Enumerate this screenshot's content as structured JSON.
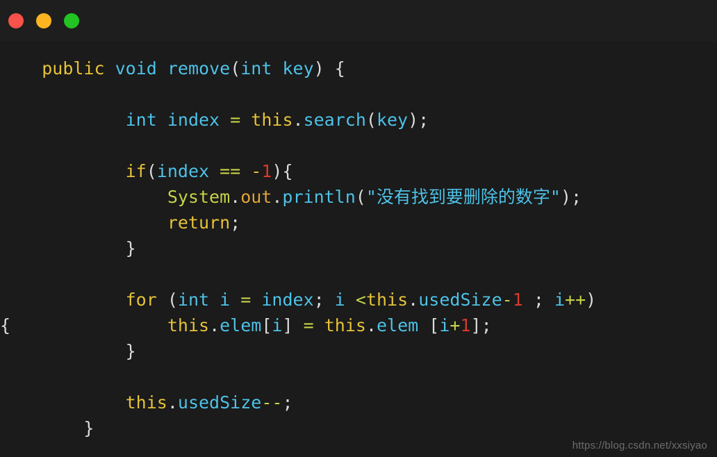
{
  "window": {
    "controls": [
      {
        "name": "close",
        "label": "Close",
        "color": "#f9524a"
      },
      {
        "name": "minimize",
        "label": "Minimize",
        "color": "#fcb521"
      },
      {
        "name": "maximize",
        "label": "Maximize",
        "color": "#22c322"
      }
    ]
  },
  "editor": {
    "language": "Java",
    "background": "#1b1b1b",
    "theme_colors": {
      "keyword": "#e6c33b",
      "identifier": "#4fc3e8",
      "operator": "#c8d44a",
      "number": "#d83c2c",
      "punctuation": "#dcdcdc",
      "class": "#c8d44a",
      "field": "#e0a63a",
      "string": "#4fc3e8"
    },
    "lines": {
      "l1_public": "public",
      "l1_void": "void",
      "l1_remove": "remove",
      "l1_paren_open": "(",
      "l1_int": "int",
      "l1_key": "key",
      "l1_paren_close": ")",
      "l1_brace": "{",
      "l3_int": "int",
      "l3_index": "index",
      "l3_eq": "=",
      "l3_this": "this",
      "l3_dot": ".",
      "l3_search": "search",
      "l3_paren_open": "(",
      "l3_key": "key",
      "l3_tail": ");",
      "l5_if": "if",
      "l5_paren_open": "(",
      "l5_index": "index",
      "l5_eqeq": "==",
      "l5_minus": "-",
      "l5_one": "1",
      "l5_tail": "){",
      "l6_system": "System",
      "l6_dot1": ".",
      "l6_out": "out",
      "l6_dot2": ".",
      "l6_println": "println",
      "l6_paren_open": "(",
      "l6_string": "\"没有找到要删除的数字\"",
      "l6_tail": ");",
      "l7_return": "return",
      "l7_semi": ";",
      "l8_close": "}",
      "l10_for": "for",
      "l10_paren_open": "(",
      "l10_int": "int",
      "l10_i": "i",
      "l10_eq": "=",
      "l10_index": "index",
      "l10_semi1": ";",
      "l10_i2": "i",
      "l10_lt": "<",
      "l10_this": "this",
      "l10_dot": ".",
      "l10_usedSize": "usedSize",
      "l10_minus": "-",
      "l10_one": "1",
      "l10_semi2": ";",
      "l10_i3": "i",
      "l10_inc": "++",
      "l10_paren_close": ")",
      "l11_wrap_brace": "{",
      "l11_this1": "this",
      "l11_dot1": ".",
      "l11_elem1": "elem",
      "l11_br_open1": "[",
      "l11_i1": "i",
      "l11_br_close1": "]",
      "l11_eq": "=",
      "l11_this2": "this",
      "l11_dot2": ".",
      "l11_elem2": "elem",
      "l11_br_open2": "[",
      "l11_i2": "i",
      "l11_plus": "+",
      "l11_one": "1",
      "l11_tail": "];",
      "l12_close": "}",
      "l14_this": "this",
      "l14_dot": ".",
      "l14_usedSize": "usedSize",
      "l14_dec": "--",
      "l14_semi": ";",
      "l15_close": "}"
    }
  },
  "watermark": {
    "text": "https://blog.csdn.net/xxsiyao"
  }
}
